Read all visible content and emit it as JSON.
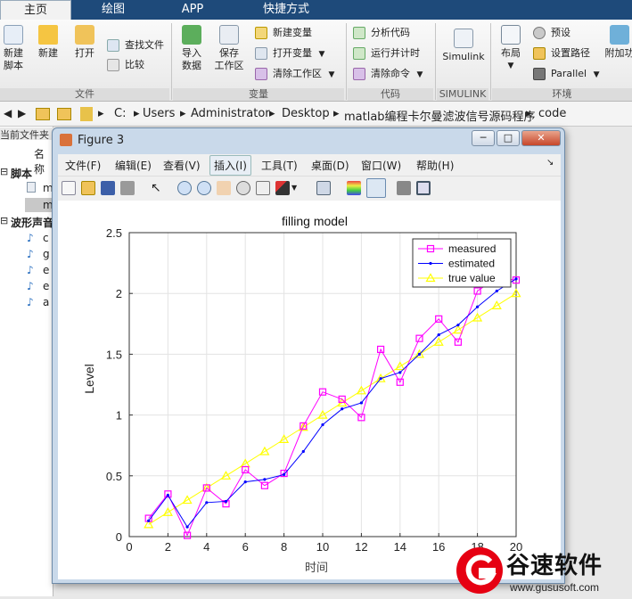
{
  "tabs": [
    "主页",
    "绘图",
    "APP",
    "快捷方式"
  ],
  "ribbon": {
    "file_group": {
      "label": "文件",
      "new_script": "新建\n脚本",
      "new": "新建",
      "open": "打开",
      "find_files": "查找文件",
      "compare": "比较"
    },
    "variable_group": {
      "label": "变量",
      "import": "导入\n数据",
      "save_ws": "保存\n工作区",
      "new_var": "新建变量",
      "open_var": "打开变量",
      "clear_ws": "清除工作区"
    },
    "code_group": {
      "label": "代码",
      "analyze": "分析代码",
      "run_time": "运行并计时",
      "clear_cmd": "清除命令"
    },
    "simulink_group": {
      "label": "SIMULINK",
      "simulink": "Simulink"
    },
    "env_group": {
      "label": "环境",
      "layout": "布局",
      "prefs": "预设",
      "set_path": "设置路径",
      "parallel": "Parallel",
      "addons": "附加功"
    }
  },
  "address": {
    "drive": "C:",
    "parts": [
      "Users",
      "Administrator",
      "Desktop",
      "matlab编程卡尔曼滤波信号源码程序",
      "code"
    ]
  },
  "left_panel": {
    "header": "当前文件夹",
    "col_name": "名称",
    "section1": "脚本",
    "section2": "波形声音",
    "items1": [
      "m",
      "m"
    ],
    "items2": [
      "c",
      "g",
      "e",
      "e",
      "a"
    ]
  },
  "figure_window": {
    "title": "Figure 3",
    "menus": [
      "文件(F)",
      "编辑(E)",
      "查看(V)",
      "插入(I)",
      "工具(T)",
      "桌面(D)",
      "窗口(W)",
      "帮助(H)"
    ]
  },
  "watermark": {
    "brand": "谷速软件",
    "url": "www.gususoft.com"
  },
  "chart_data": {
    "type": "line",
    "title": "filling model",
    "xlabel": "时间",
    "ylabel": "Level",
    "xlim": [
      0,
      20
    ],
    "ylim": [
      0,
      2.5
    ],
    "xticks": [
      0,
      2,
      4,
      6,
      8,
      10,
      12,
      14,
      16,
      18,
      20
    ],
    "yticks": [
      0,
      0.5,
      1,
      1.5,
      2,
      2.5
    ],
    "grid": true,
    "legend_position": "top-right",
    "x": [
      1,
      2,
      3,
      4,
      5,
      6,
      7,
      8,
      9,
      10,
      11,
      12,
      13,
      14,
      15,
      16,
      17,
      18,
      19,
      20
    ],
    "series": [
      {
        "name": "measured",
        "color": "#ff00ff",
        "marker": "square",
        "values": [
          0.15,
          0.35,
          0.01,
          0.4,
          0.27,
          0.55,
          0.42,
          0.52,
          0.91,
          1.19,
          1.13,
          0.98,
          1.54,
          1.27,
          1.63,
          1.79,
          1.6,
          2.02,
          2.13,
          2.11
        ]
      },
      {
        "name": "estimated",
        "color": "#0000ff",
        "marker": "dot",
        "values": [
          0.13,
          0.34,
          0.08,
          0.28,
          0.29,
          0.45,
          0.47,
          0.51,
          0.7,
          0.92,
          1.05,
          1.1,
          1.3,
          1.35,
          1.5,
          1.66,
          1.74,
          1.89,
          2.02,
          2.12
        ]
      },
      {
        "name": "true value",
        "color": "#ffff00",
        "marker": "triangle",
        "values": [
          0.1,
          0.2,
          0.3,
          0.4,
          0.5,
          0.6,
          0.7,
          0.8,
          0.9,
          1.0,
          1.1,
          1.2,
          1.3,
          1.4,
          1.5,
          1.6,
          1.7,
          1.8,
          1.9,
          2.0
        ]
      }
    ]
  }
}
